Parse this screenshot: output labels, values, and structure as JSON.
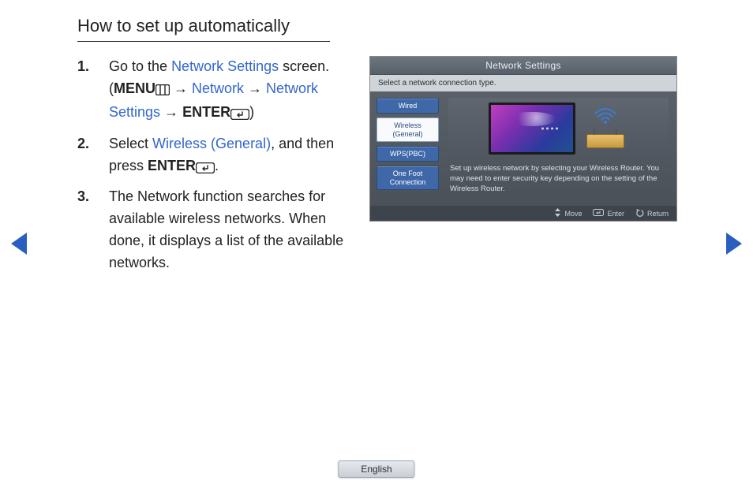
{
  "title": "How to set up automatically",
  "steps": {
    "1": {
      "pre": "Go to the ",
      "link1": "Network Settings",
      "mid1": " screen. (",
      "menu": "MENU",
      "arrow1": " → ",
      "link2": "Network",
      "arrow2": " → ",
      "link3": "Network Settings",
      "arrow3": " → ",
      "enter": "ENTER",
      "post": ")"
    },
    "2": {
      "pre": "Select ",
      "link1": "Wireless (General)",
      "mid1": ", and then press ",
      "enter": "ENTER",
      "post": "."
    },
    "3": {
      "text": "The Network function searches for available wireless networks. When done, it displays a list of the available networks."
    }
  },
  "tv": {
    "title": "Network Settings",
    "subtitle": "Select a network connection type.",
    "menu": {
      "wired": "Wired",
      "wireless": "Wireless (General)",
      "wps": "WPS(PBC)",
      "onefoot": "One Foot Connection"
    },
    "description": "Set up wireless network by selecting your Wireless Router. You may need to enter security key depending on the setting of the Wireless Router.",
    "footer": {
      "move": "Move",
      "enter": "Enter",
      "return": "Return"
    }
  },
  "language": "English"
}
